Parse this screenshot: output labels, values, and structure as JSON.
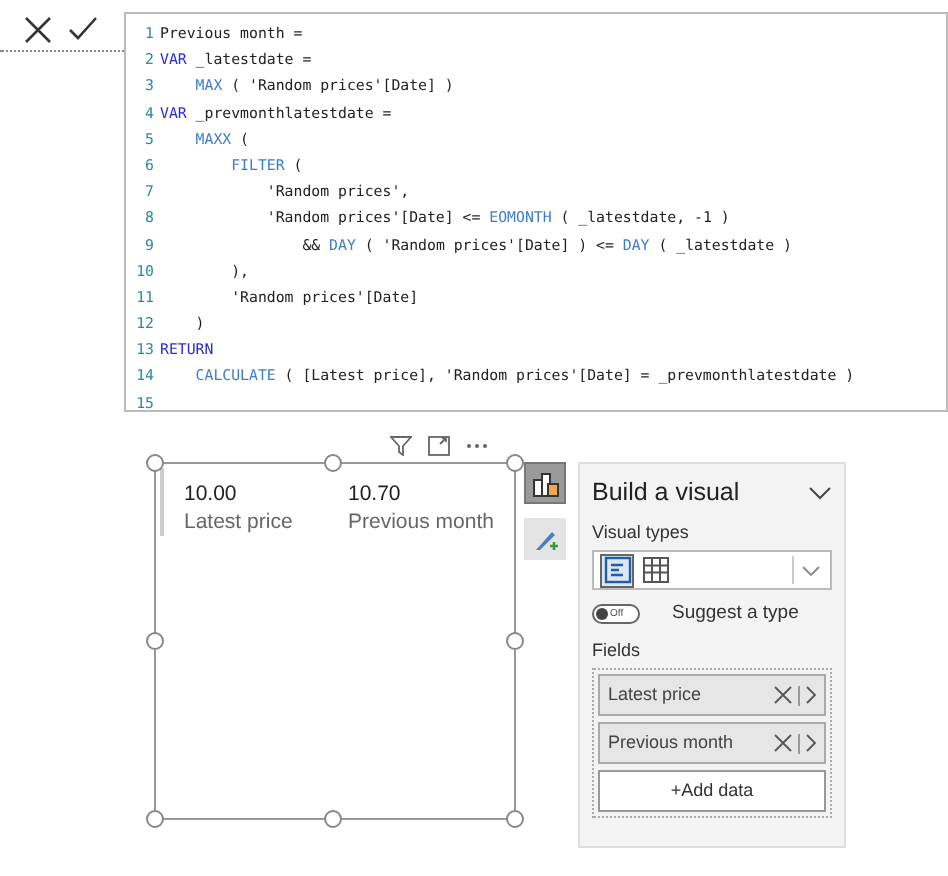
{
  "formula_bar": {
    "lines": [
      {
        "number": "1",
        "tokens": [
          {
            "text": "Previous month =",
            "kind": "plain"
          }
        ]
      },
      {
        "number": "2",
        "tokens": [
          {
            "text": "VAR",
            "kind": "keyword"
          },
          {
            "text": " _latestdate =",
            "kind": "plain"
          }
        ]
      },
      {
        "number": "3",
        "tokens": [
          {
            "text": "    MAX",
            "kind": "function"
          },
          {
            "text": " ( 'Random prices'[Date] )",
            "kind": "plain"
          }
        ]
      },
      {
        "number": "4",
        "tokens": [
          {
            "text": "VAR",
            "kind": "keyword"
          },
          {
            "text": " _prevmonthlatestdate =",
            "kind": "plain"
          }
        ]
      },
      {
        "number": "5",
        "tokens": [
          {
            "text": "    MAXX",
            "kind": "function"
          },
          {
            "text": " (",
            "kind": "plain"
          }
        ]
      },
      {
        "number": "6",
        "tokens": [
          {
            "text": "        FILTER",
            "kind": "function"
          },
          {
            "text": " (",
            "kind": "plain"
          }
        ]
      },
      {
        "number": "7",
        "tokens": [
          {
            "text": "            'Random prices',",
            "kind": "plain"
          }
        ]
      },
      {
        "number": "8",
        "tokens": [
          {
            "text": "            'Random prices'[Date] <= ",
            "kind": "plain"
          },
          {
            "text": "EOMONTH",
            "kind": "function"
          },
          {
            "text": " ( _latestdate, -1 )",
            "kind": "plain"
          }
        ]
      },
      {
        "number": "9",
        "tokens": [
          {
            "text": "                && ",
            "kind": "plain"
          },
          {
            "text": "DAY",
            "kind": "function"
          },
          {
            "text": " ( 'Random prices'[Date] ) <= ",
            "kind": "plain"
          },
          {
            "text": "DAY",
            "kind": "function"
          },
          {
            "text": " ( _latestdate )",
            "kind": "plain"
          }
        ]
      },
      {
        "number": "10",
        "tokens": [
          {
            "text": "        ),",
            "kind": "plain"
          }
        ]
      },
      {
        "number": "11",
        "tokens": [
          {
            "text": "        'Random prices'[Date]",
            "kind": "plain"
          }
        ]
      },
      {
        "number": "12",
        "tokens": [
          {
            "text": "    )",
            "kind": "plain"
          }
        ]
      },
      {
        "number": "13",
        "tokens": [
          {
            "text": "RETURN",
            "kind": "keyword"
          }
        ]
      },
      {
        "number": "14",
        "tokens": [
          {
            "text": "    CALCULATE",
            "kind": "function"
          },
          {
            "text": " ( [Latest price], 'Random prices'[Date] = _prevmonthlatestdate )",
            "kind": "plain"
          }
        ]
      },
      {
        "number": "15"
      }
    ]
  },
  "card": {
    "measures": [
      {
        "value": "10.00",
        "label": "Latest price"
      },
      {
        "value": "10.70",
        "label": "Previous month"
      }
    ]
  },
  "side_buttons": [
    {
      "kind": "build",
      "selected": true
    },
    {
      "kind": "format",
      "selected": false
    }
  ],
  "build_pane": {
    "title": "Build a visual",
    "visual_types_label": "Visual types",
    "visual_types": [
      {
        "kind": "card",
        "selected": true
      },
      {
        "kind": "table",
        "selected": false
      }
    ],
    "suggest": {
      "on": false,
      "switch_text": "Off",
      "label": "Suggest a type"
    },
    "fields_label": "Fields",
    "fields": [
      "Latest price",
      "Previous month"
    ],
    "add_data": "+Add data"
  }
}
